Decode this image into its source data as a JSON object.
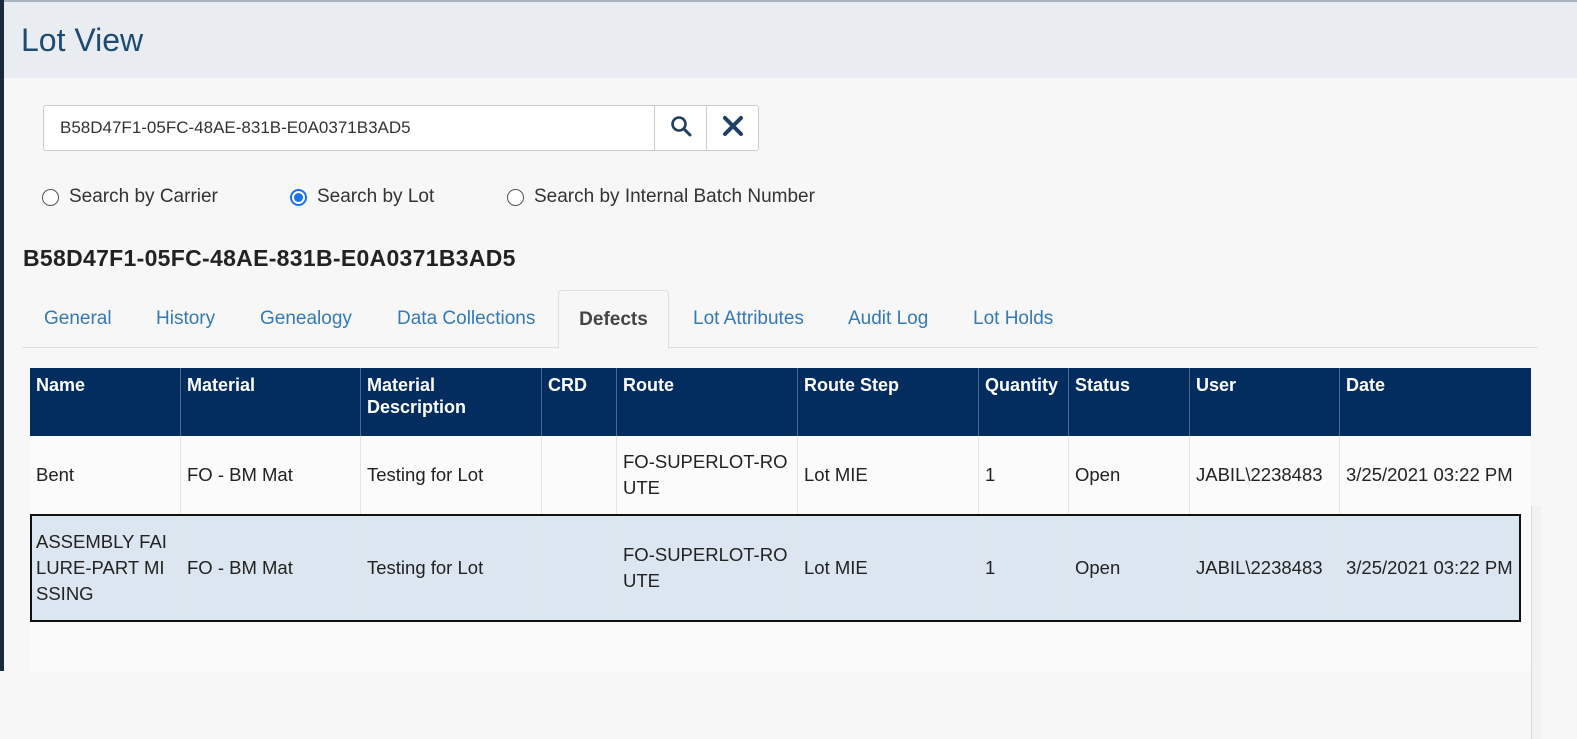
{
  "page": {
    "title": "Lot View"
  },
  "search": {
    "value": "B58D47F1-05FC-48AE-831B-E0A0371B3AD5",
    "placeholder": ""
  },
  "search_modes": [
    {
      "label": "Search by Carrier",
      "selected": false
    },
    {
      "label": "Search by Lot",
      "selected": true
    },
    {
      "label": "Search by Internal Batch Number",
      "selected": false
    }
  ],
  "lot_id": "B58D47F1-05FC-48AE-831B-E0A0371B3AD5",
  "tabs": [
    {
      "label": "General"
    },
    {
      "label": "History"
    },
    {
      "label": "Genealogy"
    },
    {
      "label": "Data Collections"
    },
    {
      "label": "Defects"
    },
    {
      "label": "Lot Attributes"
    },
    {
      "label": "Audit Log"
    },
    {
      "label": "Lot Holds"
    }
  ],
  "active_tab": "Defects",
  "table": {
    "columns": [
      "Name",
      "Material",
      "Material Description",
      "CRD",
      "Route",
      "Route Step",
      "Quantity",
      "Status",
      "User",
      "Date"
    ],
    "rows": [
      [
        "Bent",
        "FO - BM Mat",
        "Testing for Lot",
        "",
        "FO-SUPERLOT-ROUTE",
        "Lot MIE",
        "1",
        "Open",
        "JABIL\\2238483",
        "3/25/2021 03:22 PM"
      ],
      [
        "ASSEMBLY FAILURE-PART MISSING",
        "FO - BM Mat",
        "Testing for Lot",
        "",
        "FO-SUPERLOT-ROUTE",
        "Lot MIE",
        "1",
        "Open",
        "JABIL\\2238483",
        "3/25/2021 03:22 PM"
      ]
    ],
    "selected_row": 1
  },
  "colors": {
    "header_bg": "#022d5e",
    "title": "#1f4b73",
    "link": "#337ab7",
    "selected_row_bg": "#dce6f0",
    "radio_accent": "#1a73e8"
  },
  "icons": {
    "search": "search-icon",
    "clear": "close-icon"
  }
}
